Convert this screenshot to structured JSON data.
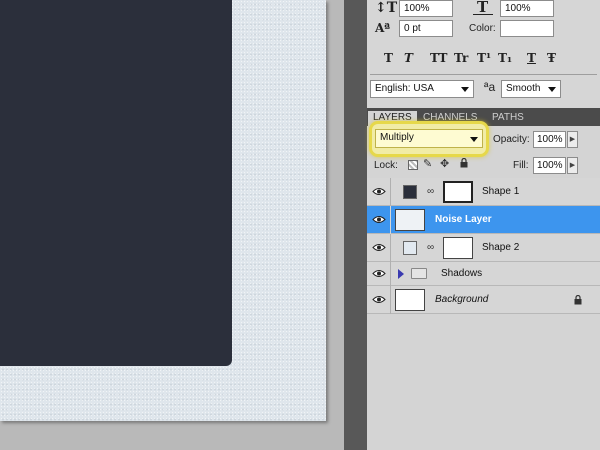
{
  "character_panel": {
    "vertical_scale_icon": "vertical-scale-icon",
    "vertical_scale_value": "100%",
    "horizontal_scale_icon": "horizontal-scale-icon",
    "horizontal_scale_value": "100%",
    "baseline_icon": "baseline-shift-icon",
    "baseline_value": "0 pt",
    "color_label": "Color:",
    "style_buttons": [
      "T",
      "T",
      "TT",
      "Tr",
      "T¹",
      "T₁",
      "T",
      "Ŧ"
    ],
    "language_value": "English: USA",
    "antialias_icon_text": "ªa",
    "antialias_value": "Smooth"
  },
  "layers_panel": {
    "tabs": [
      "LAYERS",
      "CHANNELS",
      "PATHS"
    ],
    "blend_mode": "Multiply",
    "opacity_label": "Opacity:",
    "opacity_value": "100%",
    "lock_label": "Lock:",
    "fill_label": "Fill:",
    "fill_value": "100%",
    "layers": [
      {
        "name": "Shape 1",
        "visible": true,
        "swatch_color": "#2b2f3b"
      },
      {
        "name": "Noise Layer",
        "visible": true,
        "selected": true
      },
      {
        "name": "Shape 2",
        "visible": true,
        "swatch_color": "#e2e9f0"
      },
      {
        "name": "Shadows",
        "visible": true,
        "type": "group"
      },
      {
        "name": "Background",
        "visible": true,
        "locked": true
      }
    ]
  },
  "colors": {
    "canvas_paper": "#dfe6ec",
    "dark_shape": "#2b2f3b",
    "selection": "#3d95ee",
    "highlight": "#e6d84a"
  }
}
